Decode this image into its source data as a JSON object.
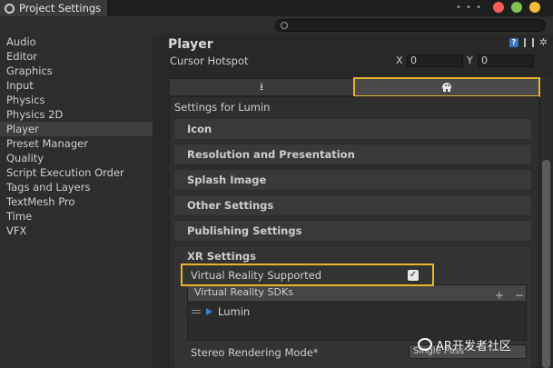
{
  "window": {
    "title": "Project Settings",
    "dots": "• • •",
    "buttons": [
      {
        "name": "close",
        "color": "#f55d58"
      },
      {
        "name": "minimize",
        "color": "#7fc54f"
      },
      {
        "name": "zoom",
        "color": "#f5b93a"
      }
    ]
  },
  "sidebar": {
    "items": [
      {
        "label": "Audio"
      },
      {
        "label": "Editor"
      },
      {
        "label": "Graphics"
      },
      {
        "label": "Input"
      },
      {
        "label": "Physics"
      },
      {
        "label": "Physics 2D"
      },
      {
        "label": "Player",
        "selected": true
      },
      {
        "label": "Preset Manager"
      },
      {
        "label": "Quality"
      },
      {
        "label": "Script Execution Order"
      },
      {
        "label": "Tags and Layers"
      },
      {
        "label": "TextMesh Pro"
      },
      {
        "label": "Time"
      },
      {
        "label": "VFX"
      }
    ]
  },
  "main": {
    "title": "Player",
    "cursor_hotspot": {
      "label": "Cursor Hotspot",
      "x_label": "X",
      "x_value": "0",
      "y_label": "Y",
      "y_value": "0"
    },
    "platform_tabs": [
      {
        "icon": "download-icon",
        "active": false
      },
      {
        "icon": "lumin-icon",
        "active": true
      }
    ],
    "settings_for": "Settings for Lumin",
    "sections": [
      {
        "label": "Icon"
      },
      {
        "label": "Resolution and Presentation"
      },
      {
        "label": "Splash Image"
      },
      {
        "label": "Other Settings"
      },
      {
        "label": "Publishing Settings"
      }
    ],
    "xr": {
      "title": "XR Settings",
      "vr_supported_label": "Virtual Reality Supported",
      "vr_supported_checked": true,
      "sdk_header": "Virtual Reality SDKs",
      "sdk_items": [
        {
          "label": "Lumin"
        }
      ],
      "plus": "+",
      "minus": "−",
      "stereo_label": "Stereo Rendering Mode*",
      "stereo_value": "Single Pass"
    }
  },
  "watermark": {
    "text": "AR开发者社区"
  },
  "colors": {
    "highlight": "#e9b52a",
    "accent_blue": "#3d7fd6"
  }
}
